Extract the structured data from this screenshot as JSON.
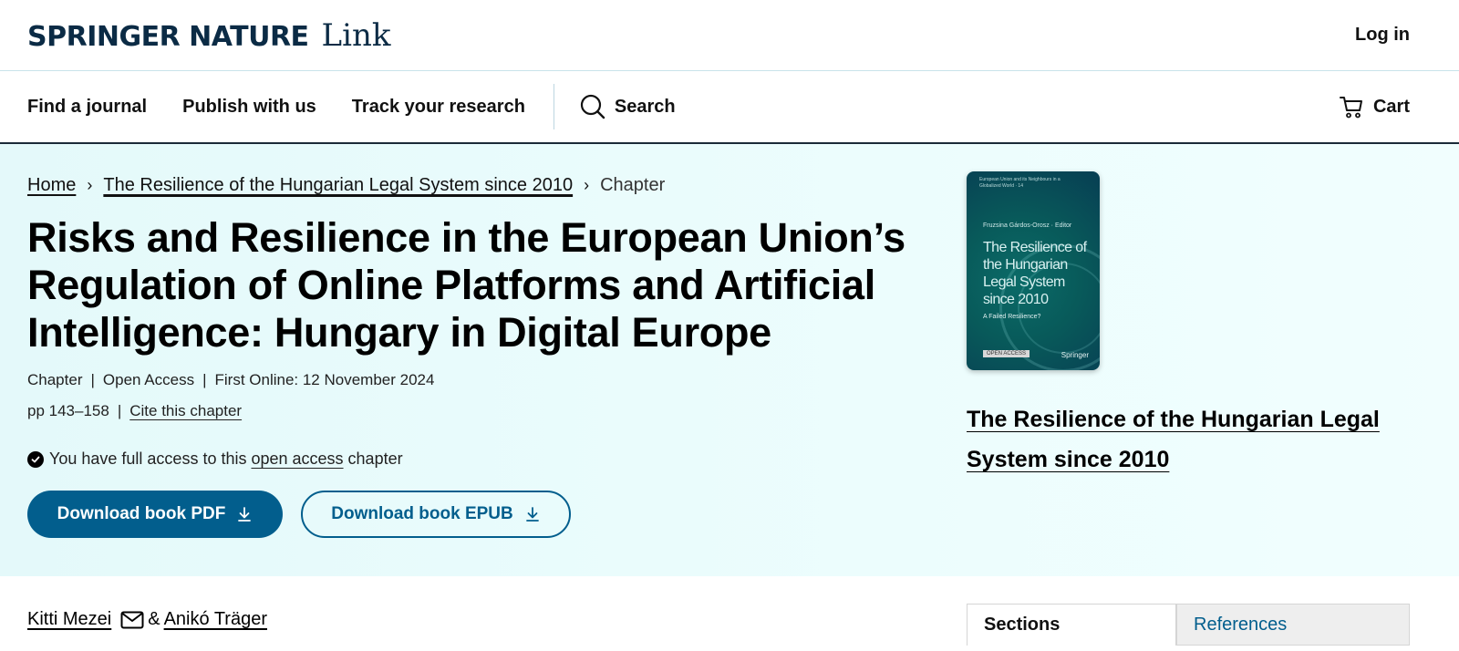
{
  "header": {
    "logo_brand": "SPRINGER NATURE",
    "logo_product": "Link",
    "login_label": "Log in"
  },
  "nav": {
    "items": [
      "Find a journal",
      "Publish with us",
      "Track your research"
    ],
    "search_label": "Search",
    "cart_label": "Cart"
  },
  "breadcrumb": {
    "home": "Home",
    "book": "The Resilience of the Hungarian Legal System since 2010",
    "current": "Chapter"
  },
  "chapter": {
    "title": "Risks and Resilience in the European Union’s Regulation of Online Platforms and Artificial Intelligence: Hungary in Digital Europe",
    "type": "Chapter",
    "access": "Open Access",
    "first_online": "First Online: 12 November 2024",
    "pages": "pp 143–158",
    "cite_label": "Cite this chapter",
    "access_prefix": "You have full access to this",
    "access_link": "open access",
    "access_suffix": "chapter",
    "download_pdf": "Download book PDF",
    "download_epub": "Download book EPUB"
  },
  "book": {
    "cover": {
      "series": "European Union and its Neighbours in a Globalized World · 14",
      "editor": "Fruzsina Gárdos-Orosz · Editor",
      "title": "The Resilience of the Hungarian Legal System since 2010",
      "subtitle": "A Failed Resilience?",
      "badge": "OPEN ACCESS",
      "publisher": "Springer"
    },
    "title": "The Resilience of the Hungarian Legal System since 2010"
  },
  "authors": {
    "first": "Kitti Mezei",
    "connector": "&",
    "second": "Anikó Träger"
  },
  "tabs": {
    "sections": "Sections",
    "references": "References"
  },
  "colors": {
    "brand_blue": "#025e8d",
    "logo_navy": "#0b2b45",
    "hero_bg": "#e4f9fa"
  }
}
